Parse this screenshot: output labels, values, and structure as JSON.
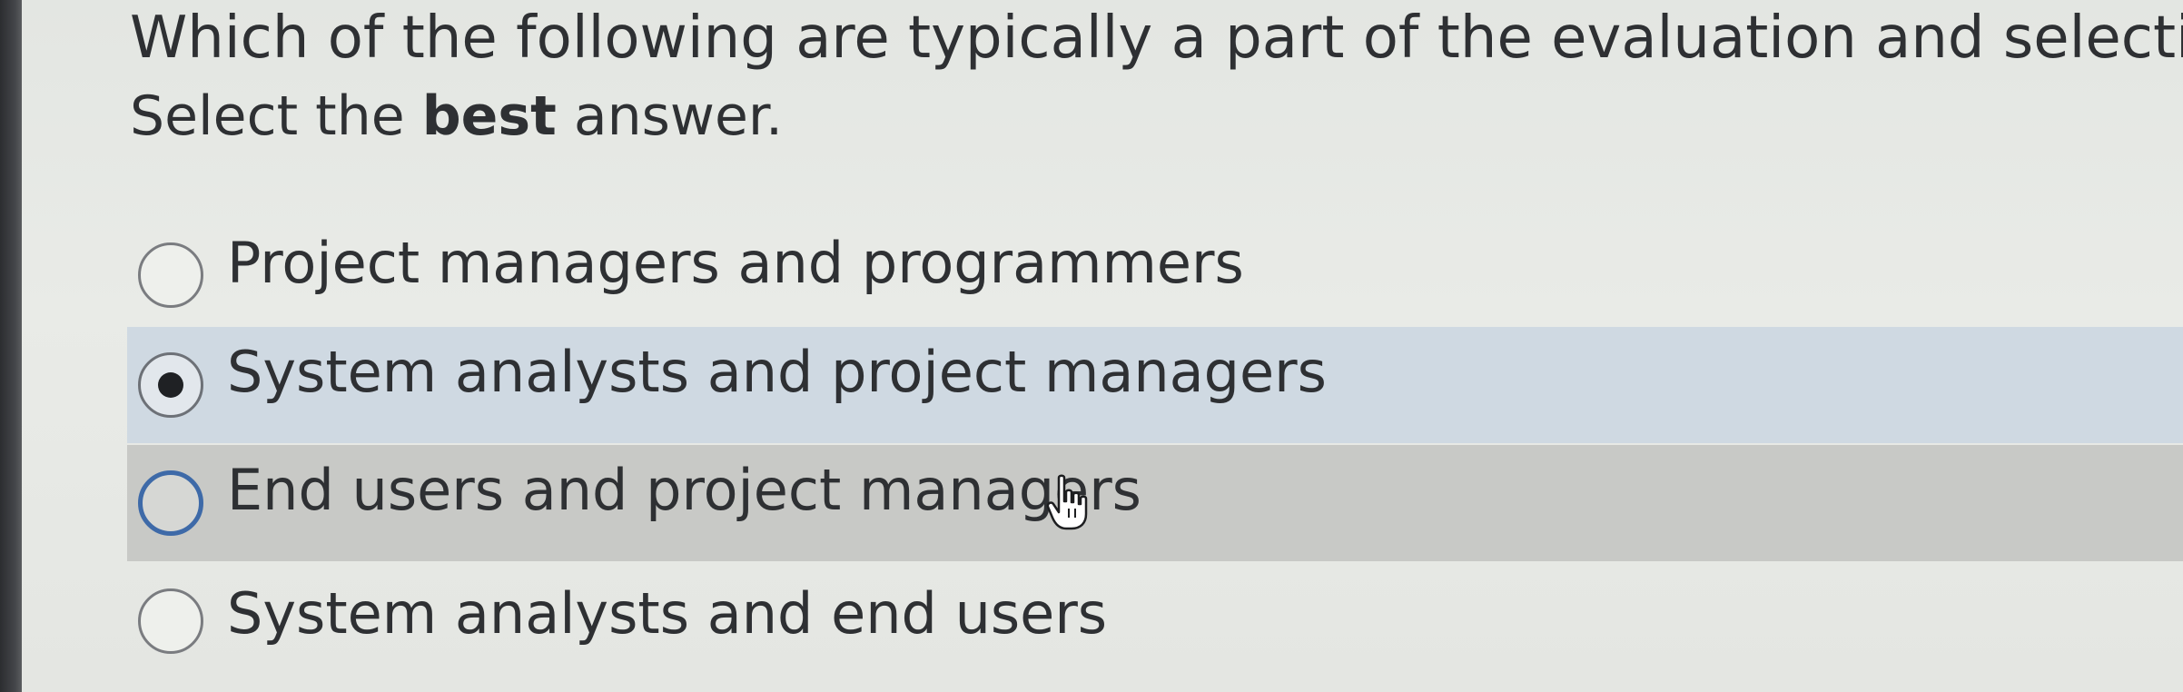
{
  "question": {
    "text": "Which of the following are typically a part of the evaluation and selection team",
    "instruction_prefix": "Select the ",
    "instruction_bold": "best",
    "instruction_suffix": " answer."
  },
  "options": [
    {
      "label": "Project managers and programmers",
      "selected": false
    },
    {
      "label": "System analysts and project managers",
      "selected": true
    },
    {
      "label": "End users and project managers",
      "selected": false,
      "hovered": true
    },
    {
      "label": "System analysts and end users",
      "selected": false
    }
  ],
  "colors": {
    "background": "#e7e9e5",
    "selected_row": "#cfd9e2",
    "hover_row": "#c8c9c6",
    "focus_ring": "#3e6aa8",
    "text": "#2e3033"
  },
  "icons": {
    "cursor": "hand-pointer-icon"
  }
}
